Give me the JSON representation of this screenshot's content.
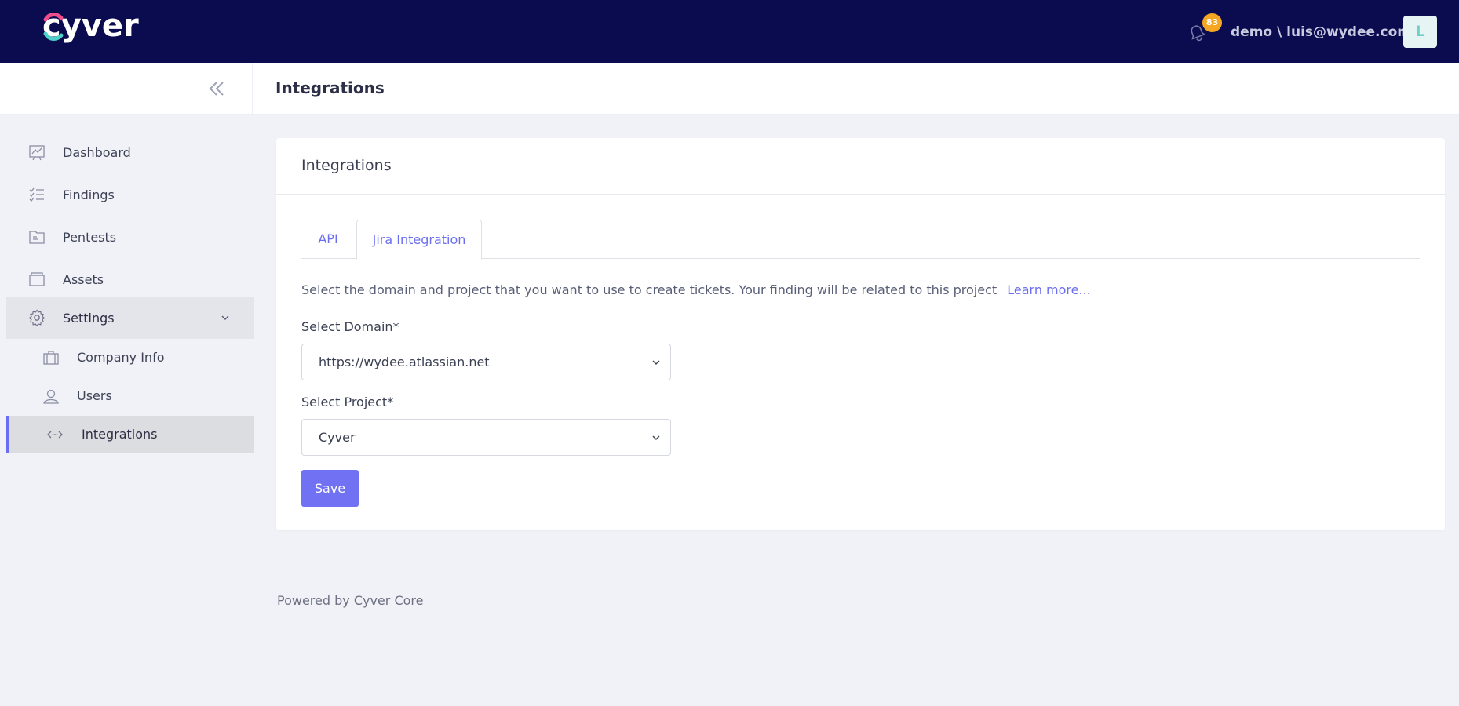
{
  "header": {
    "logo_text": "cyver",
    "notification_count": "83",
    "user_label": "demo \\ luis@wydee.com",
    "avatar_initial": "L"
  },
  "titlebar": {
    "title": "Integrations"
  },
  "sidebar": {
    "items": [
      {
        "label": "Dashboard",
        "icon": "dashboard-icon"
      },
      {
        "label": "Findings",
        "icon": "findings-icon"
      },
      {
        "label": "Pentests",
        "icon": "pentests-icon"
      },
      {
        "label": "Assets",
        "icon": "assets-icon"
      },
      {
        "label": "Settings",
        "icon": "gear-icon",
        "expanded": true
      }
    ],
    "sub_items": [
      {
        "label": "Company Info",
        "icon": "briefcase-icon"
      },
      {
        "label": "Users",
        "icon": "users-icon"
      },
      {
        "label": "Integrations",
        "icon": "integrations-icon",
        "active": true
      }
    ]
  },
  "card": {
    "title": "Integrations",
    "tabs": [
      {
        "label": "API"
      },
      {
        "label": "Jira Integration",
        "active": true
      }
    ],
    "description": "Select the domain and project that you want to use to create tickets. Your finding will be related to this project",
    "learn_more": "Learn more...",
    "domain_label": "Select Domain*",
    "domain_value": "https://wydee.atlassian.net",
    "project_label": "Select Project*",
    "project_value": "Cyver",
    "save_label": "Save"
  },
  "footer": {
    "text": "Powered by Cyver Core"
  },
  "colors": {
    "header_bg": "#0b0b4f",
    "accent": "#6b6ef0",
    "badge": "#f5a623",
    "logo_pink": "#ef4d8c",
    "logo_teal": "#4fd0c8"
  }
}
